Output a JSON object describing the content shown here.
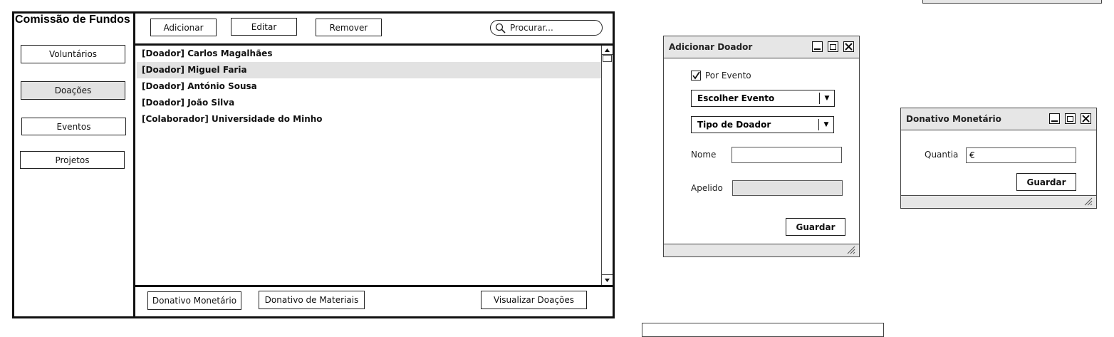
{
  "app": {
    "title": "Comissão de Fundos",
    "nav": {
      "voluntarios": "Voluntários",
      "doacoes": "Doações",
      "eventos": "Eventos",
      "projetos": "Projetos"
    },
    "toolbar": {
      "add": "Adicionar",
      "edit": "Editar",
      "remove": "Remover",
      "search_placeholder": "Procurar..."
    },
    "list": [
      "[Doador] Carlos Magalhães",
      "[Doador] Miguel Faria",
      "[Doador] António Sousa",
      "[Doador] João Silva",
      "[Colaborador] Universidade do Minho"
    ],
    "selected_index": 1,
    "footer": {
      "monetary": "Donativo Monetário",
      "materials": "Donativo de Materiais",
      "view": "Visualizar Doações"
    }
  },
  "add_donor": {
    "title": "Adicionar Doador",
    "by_event_label": "Por Evento",
    "by_event_checked": true,
    "choose_event": "Escolher Evento",
    "donor_type": "Tipo de Doador",
    "name_label": "Nome",
    "surname_label": "Apelido",
    "save": "Guardar"
  },
  "monetary": {
    "title": "Donativo Monetário",
    "amount_label": "Quantia",
    "amount_value": "€",
    "save": "Guardar"
  },
  "colors": {
    "selected_bg": "#e2e2e2",
    "titlebar_bg": "#e6e6e6"
  }
}
